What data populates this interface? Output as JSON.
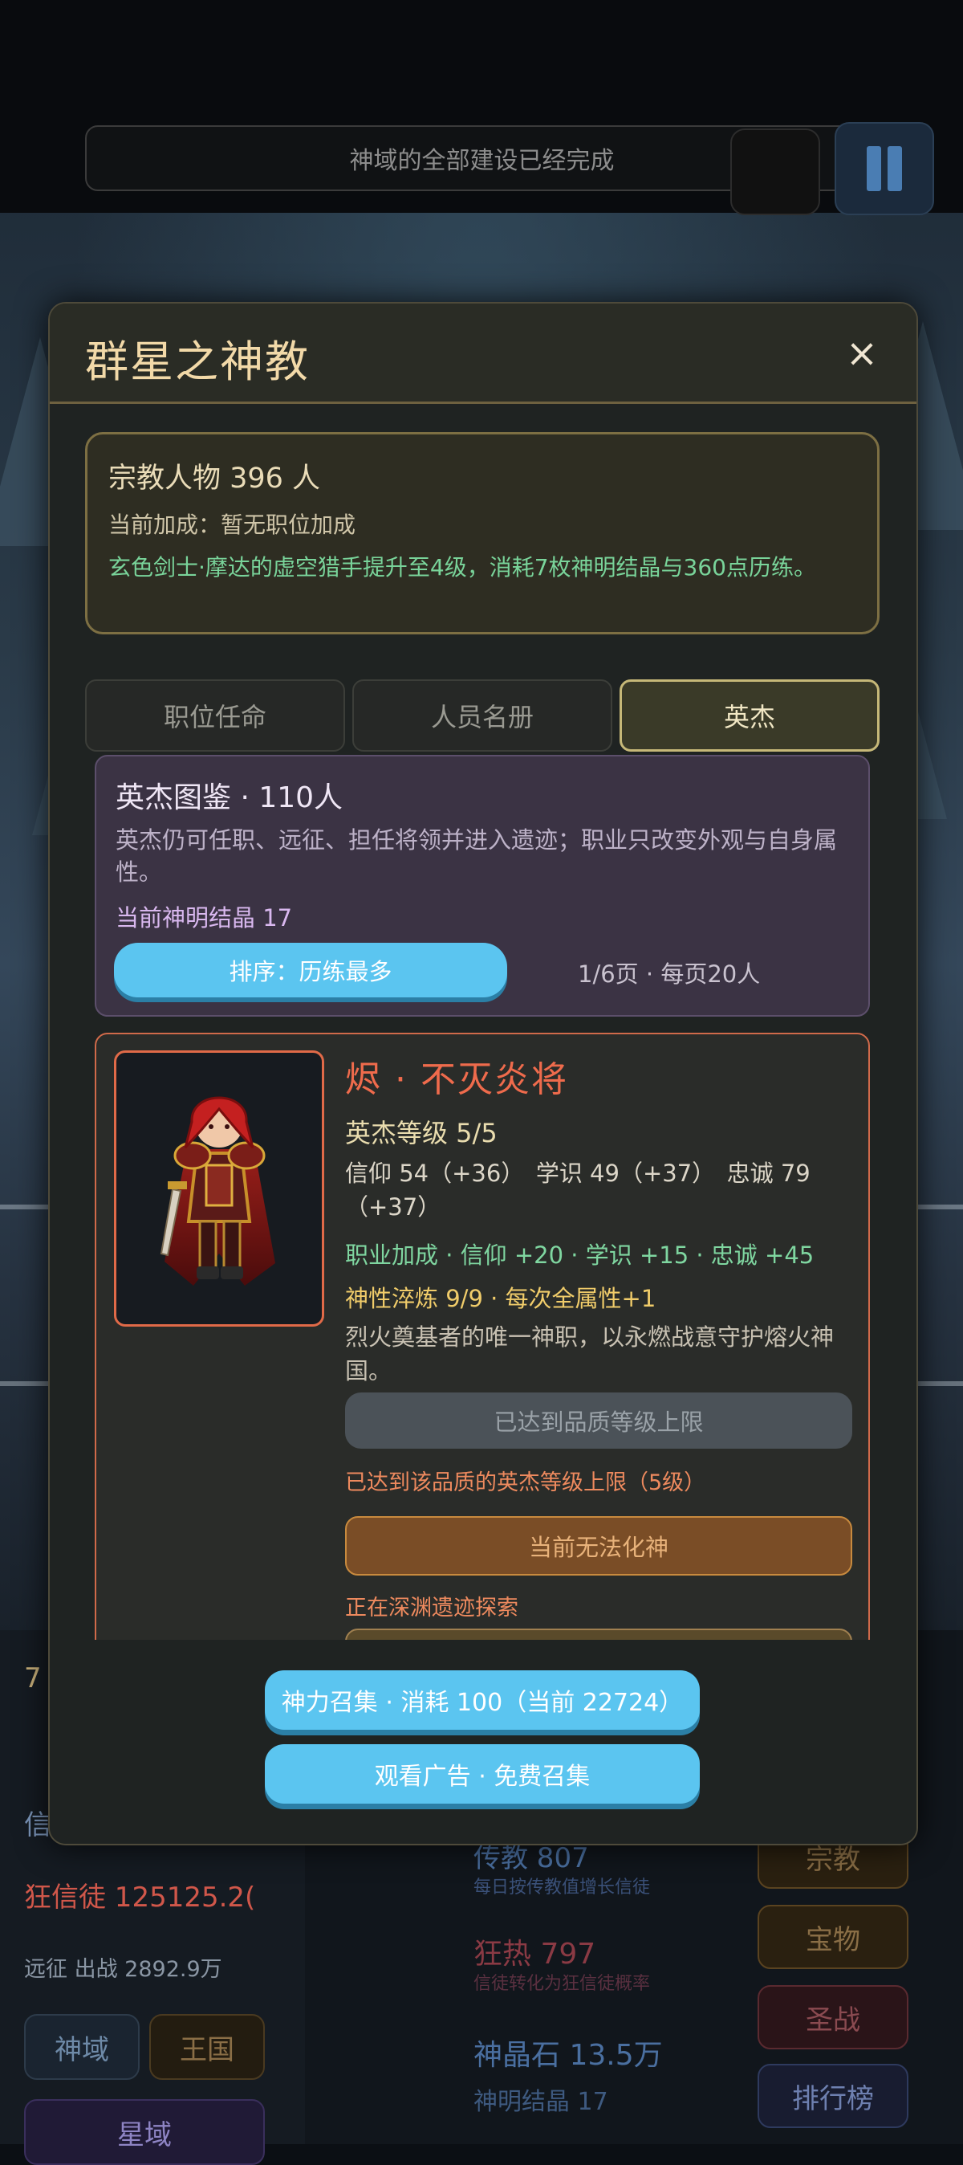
{
  "notice": {
    "text": "神域的全部建设已经完成"
  },
  "background": {
    "left_value": "7",
    "faith_label": "信",
    "zealot_text": "狂信徒 125125.2(",
    "expedition_text": "远征 出战 2892.9万",
    "nav": [
      "神域",
      "王国",
      "星域"
    ],
    "preach": "传教 807",
    "preach_desc": "每日按传教值增长信徒",
    "zeal": "狂热 797",
    "zeal_desc": "信徒转化为狂信徒概率",
    "crystal_stone": "神晶石 13.5万",
    "divine_crystal": "神明结晶 17",
    "side_buttons": [
      "宗教",
      "宝物",
      "圣战",
      "排行榜"
    ]
  },
  "modal": {
    "title": "群星之神教",
    "close": "×",
    "info": {
      "count": "宗教人物 396 人",
      "bonus": "当前加成：暂无职位加成",
      "log": "玄色剑士·摩达的虚空猎手提升至4级，消耗7枚神明结晶与360点历练。"
    },
    "tabs": [
      "职位任命",
      "人员名册",
      "英杰"
    ],
    "active_tab": 2,
    "summary": {
      "title": "英杰图鉴 · 110人",
      "desc": "英杰仍可任职、远征、担任将领并进入遗迹；职业只改变外观与自身属性。",
      "crystal": "当前神明结晶 17",
      "sort": "排序：历练最多",
      "page": "1/6页 · 每页20人"
    },
    "hero": {
      "name": "烬 · 不灭炎将",
      "level": "英杰等级 5/5",
      "stats": "信仰 54（+36）　学识 49（+37）　忠诚 79（+37）",
      "job_bonus": "职业加成 · 信仰 +20 · 学识 +15 · 忠诚 +45",
      "divine": "神性淬炼 9/9 · 每次全属性+1",
      "desc": "烈火奠基者的唯一神职，以永燃战意守护熔火神国。",
      "maxed_btn": "已达到品质等级上限",
      "maxed_note": "已达到该品质的英杰等级上限（5级）",
      "deify_btn": "当前无法化神",
      "explore_note": "正在深渊遗迹探索"
    },
    "footer": {
      "summon": "神力召集 · 消耗 100（当前 22724）",
      "ad": "观看广告 · 免费召集"
    }
  },
  "colors": {
    "accent_blue": "#5bc5f0",
    "hero_red": "#ef6b4c",
    "gold": "#f2d9a8",
    "green": "#79d49a"
  }
}
